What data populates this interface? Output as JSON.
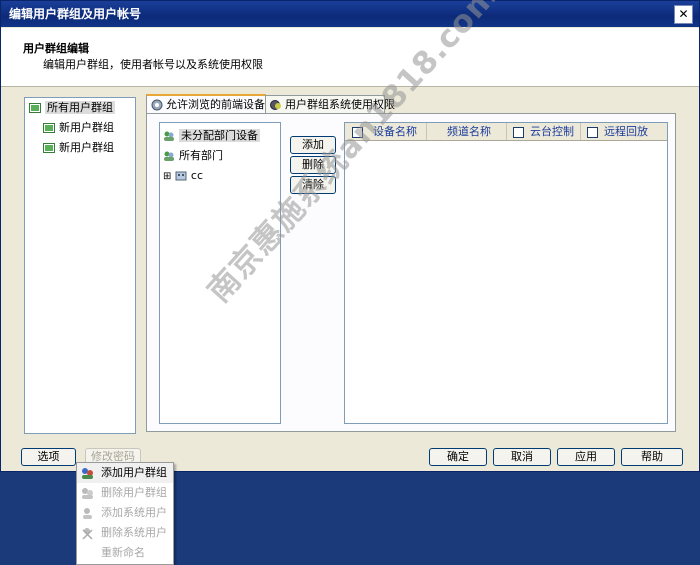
{
  "window": {
    "title": "编辑用户群组及用户帐号",
    "close_glyph": "✕"
  },
  "header": {
    "title": "用户群组编辑",
    "subtitle": "编辑用户群组，使用者帐号以及系统使用权限"
  },
  "groups": {
    "root": "所有用户群组",
    "items": [
      "新用户群组",
      "新用户群组"
    ]
  },
  "tabs": [
    {
      "label": "允许浏览的前端设备"
    },
    {
      "label": "用户群组系统使用权限"
    }
  ],
  "device_tree": {
    "items": [
      "未分配部门设备",
      "所有部门",
      "cc"
    ],
    "expand_glyph": "⊞"
  },
  "device_buttons": {
    "add": "添加",
    "remove": "删除",
    "clear": "清除"
  },
  "grid": {
    "columns": [
      "设备名称",
      "频道名称",
      "云台控制",
      "远程回放"
    ]
  },
  "bottom": {
    "options": "选项",
    "change_password": "修改密码",
    "ok": "确定",
    "cancel": "取消",
    "apply": "应用",
    "help": "帮助"
  },
  "context_menu": {
    "items": [
      "添加用户群组",
      "删除用户群组",
      "添加系统用户",
      "删除系统用户",
      "重新命名"
    ]
  },
  "watermark": "南京惠施系统an1818.com",
  "colors": {
    "title_bar": "#0c2a78",
    "tab_accent": "#e8a838",
    "header_text": "#1c3c9c",
    "desktop": "#1a3a7a"
  }
}
